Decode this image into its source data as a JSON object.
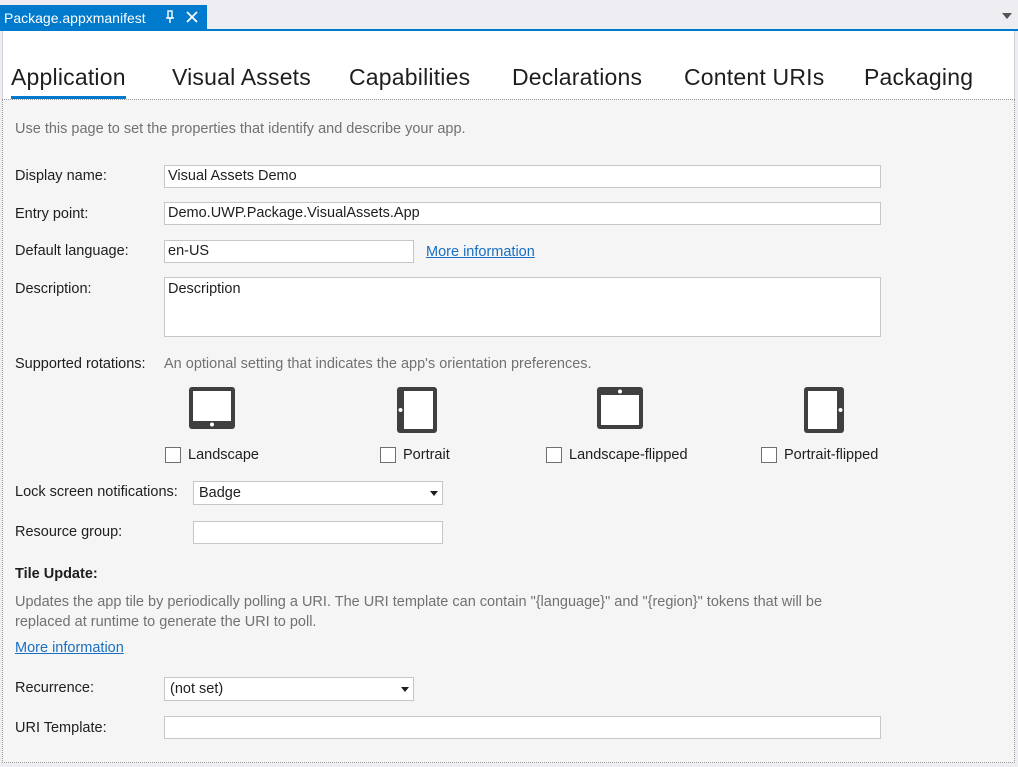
{
  "document_tab": {
    "title": "Package.appxmanifest",
    "pin_icon": "pin-icon",
    "close_icon": "close-icon"
  },
  "nav_tabs": [
    {
      "label": "Application",
      "active": true
    },
    {
      "label": "Visual Assets"
    },
    {
      "label": "Capabilities"
    },
    {
      "label": "Declarations"
    },
    {
      "label": "Content URIs"
    },
    {
      "label": "Packaging"
    }
  ],
  "intro": "Use this page to set the properties that identify and describe your app.",
  "display_name": {
    "label": "Display name:",
    "value": "Visual Assets Demo"
  },
  "entry_point": {
    "label": "Entry point:",
    "value": "Demo.UWP.Package.VisualAssets.App"
  },
  "default_language": {
    "label": "Default language:",
    "value": "en-US",
    "link": "More information"
  },
  "description": {
    "label": "Description:",
    "value": "Description"
  },
  "rotations": {
    "label": "Supported rotations:",
    "hint": "An optional setting that indicates the app's orientation preferences.",
    "options": [
      {
        "label": "Landscape",
        "icon": "tablet-landscape-icon",
        "checked": false
      },
      {
        "label": "Portrait",
        "icon": "tablet-portrait-icon",
        "checked": false
      },
      {
        "label": "Landscape-flipped",
        "icon": "tablet-landscape-flipped-icon",
        "checked": false
      },
      {
        "label": "Portrait-flipped",
        "icon": "tablet-portrait-flipped-icon",
        "checked": false
      }
    ]
  },
  "lock_screen": {
    "label": "Lock screen notifications:",
    "value": "Badge"
  },
  "resource_group": {
    "label": "Resource group:",
    "value": ""
  },
  "tile_update": {
    "heading": "Tile Update:",
    "desc_line1": "Updates the app tile by periodically polling a URI. The URI template can contain \"{language}\" and \"{region}\" tokens that will be",
    "desc_line2": "replaced at runtime to generate the URI to poll.",
    "link": "More information",
    "recurrence_label": "Recurrence:",
    "recurrence_value": "(not set)",
    "uri_label": "URI Template:",
    "uri_value": ""
  },
  "colors": {
    "accent": "#007acc",
    "link": "#1a6fc2",
    "muted_text": "#717171"
  }
}
